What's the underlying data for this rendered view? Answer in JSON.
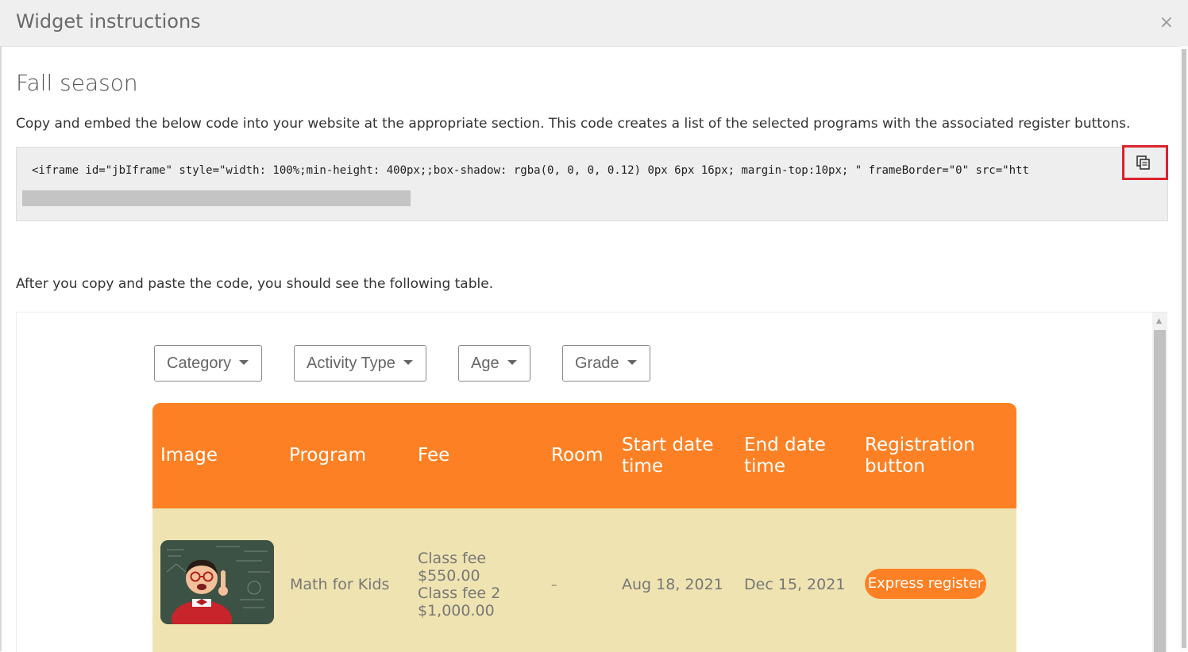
{
  "modal": {
    "title": "Widget instructions",
    "close_label": "×"
  },
  "section": {
    "title": "Fall season",
    "instructions": "Copy and embed the below code into your website at the appropriate section. This code creates a list of the selected programs with the associated register buttons.",
    "code": "<iframe id=\"jbIframe\" style=\"width: 100%;min-height: 400px;;box-shadow: rgba(0, 0, 0, 0.12) 0px 6px 16px; margin-top:10px; \" frameBorder=\"0\" src=\"htt",
    "copy_icon": "copy-icon",
    "after_text": "After you copy and paste the code, you should see the following table."
  },
  "filters": [
    {
      "label": "Category"
    },
    {
      "label": "Activity Type"
    },
    {
      "label": "Age"
    },
    {
      "label": "Grade"
    }
  ],
  "table": {
    "headers": {
      "image": "Image",
      "program": "Program",
      "fee": "Fee",
      "room": "Room",
      "start_line1": "Start date",
      "start_line2": "time",
      "end_line1": "End date",
      "end_line2": "time",
      "reg_line1": "Registration",
      "reg_line2": "button"
    },
    "rows": [
      {
        "image": "kid-with-chalkboard-photo",
        "program": "Math for Kids",
        "fee_lines": [
          "Class fee",
          "$550.00",
          "Class fee 2",
          "$1,000.00"
        ],
        "room": "–",
        "start": "Aug 18, 2021",
        "end": "Dec 15, 2021",
        "button": "Express register"
      }
    ]
  },
  "colors": {
    "accent": "#fd8124",
    "row_bg": "#efe4b1",
    "highlight_border": "#d9232e"
  }
}
